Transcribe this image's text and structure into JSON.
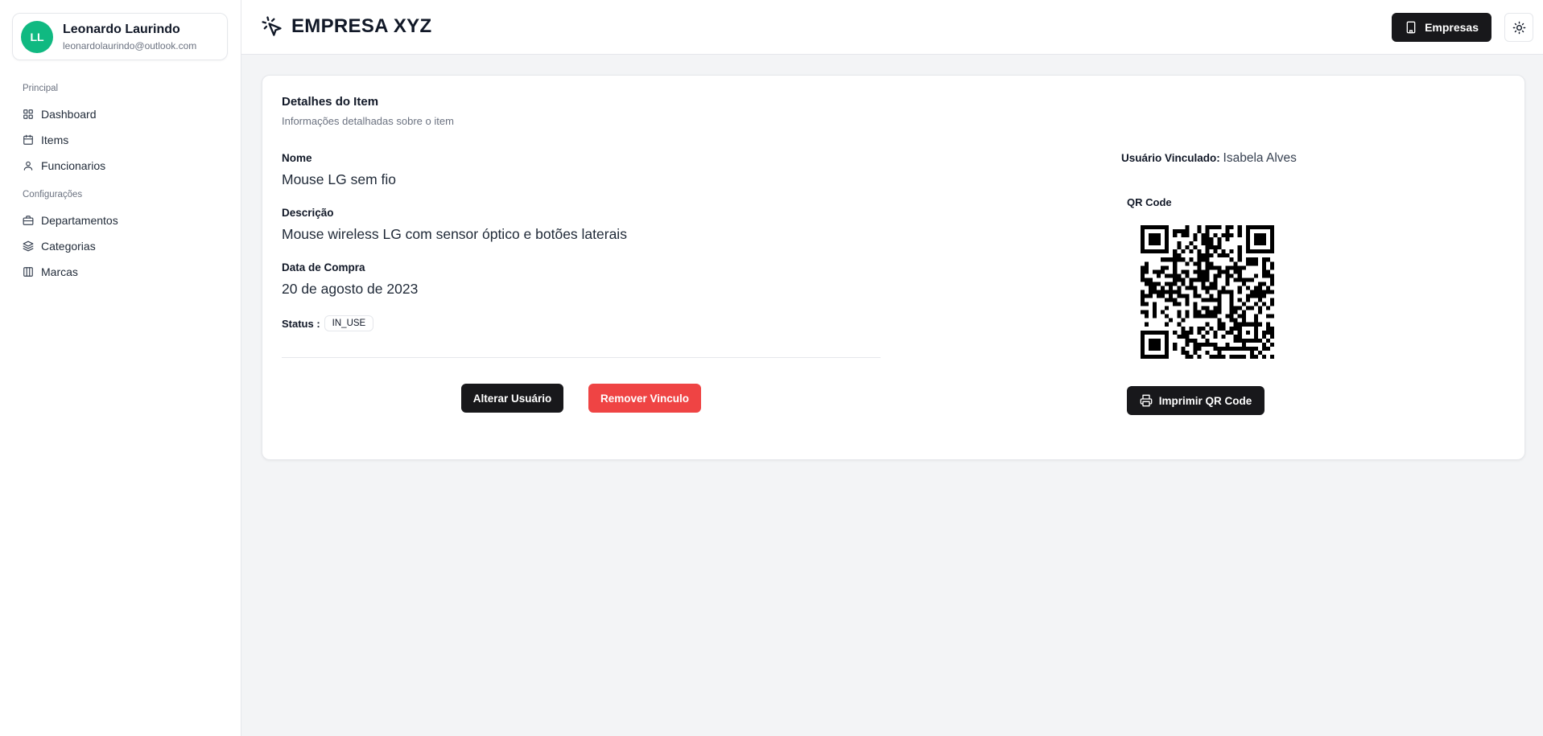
{
  "user": {
    "initials": "LL",
    "name": "Leonardo Laurindo",
    "email": "leonardolaurindo@outlook.com"
  },
  "sidebar": {
    "groups": [
      {
        "label": "Principal",
        "items": [
          {
            "label": "Dashboard",
            "icon": "grid-icon"
          },
          {
            "label": "Items",
            "icon": "calendar-icon"
          },
          {
            "label": "Funcionarios",
            "icon": "user-icon"
          }
        ]
      },
      {
        "label": "Configurações",
        "items": [
          {
            "label": "Departamentos",
            "icon": "briefcase-icon"
          },
          {
            "label": "Categorias",
            "icon": "layers-icon"
          },
          {
            "label": "Marcas",
            "icon": "columns-icon"
          }
        ]
      }
    ]
  },
  "header": {
    "title": "EMPRESA XYZ",
    "empresas_label": "Empresas",
    "logo_icon": "cursor-click-icon",
    "theme_icon": "sun-icon"
  },
  "card": {
    "title": "Detalhes do Item",
    "subtitle": "Informações detalhadas sobre o item",
    "fields": {
      "nome": {
        "label": "Nome",
        "value": "Mouse LG sem fio"
      },
      "descricao": {
        "label": "Descrição",
        "value": "Mouse wireless LG com sensor óptico e botões laterais"
      },
      "data": {
        "label": "Data de Compra",
        "value": "20 de agosto de 2023"
      }
    },
    "status": {
      "label": "Status :",
      "value": "IN_USE"
    },
    "buttons": {
      "alterar": "Alterar Usuário",
      "remover": "Remover Vinculo"
    },
    "linked_user": {
      "label": "Usuário Vinculado:",
      "value": "Isabela Alves"
    },
    "qr": {
      "label": "QR Code",
      "print_label": "Imprimir QR Code"
    }
  },
  "colors": {
    "primary": "#18181b",
    "danger": "#ef4444",
    "avatar": "#10b981",
    "background": "#f3f4f6"
  }
}
